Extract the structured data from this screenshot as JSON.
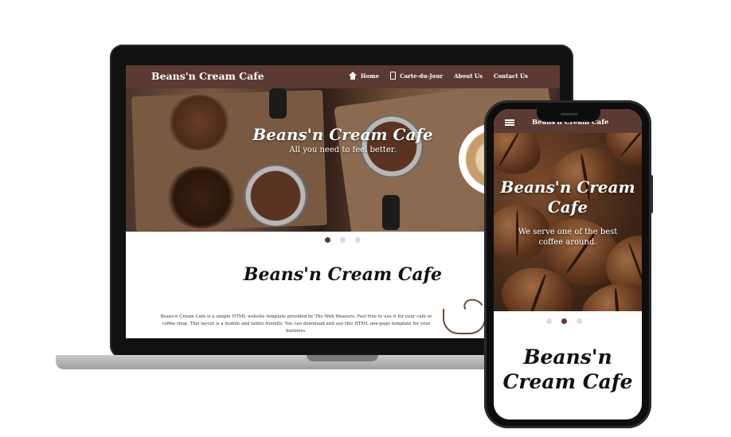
{
  "desktop": {
    "brand": "Beans'n Cream Cafe",
    "nav": [
      {
        "label": "Home",
        "icon": "home-icon"
      },
      {
        "label": "Carte-du-Jour",
        "icon": "clipboard-icon"
      },
      {
        "label": "About Us"
      },
      {
        "label": "Contact Us"
      }
    ],
    "hero": {
      "title": "Beans'n Cream Cafe",
      "subtitle": "All you need to feel better."
    },
    "carousel": {
      "count": 3,
      "active": 1
    },
    "section": {
      "title": "Beans'n Cream Cafe",
      "text": "Beans'n Cream Cafe is a simple HTML website template provided by The Web Weavers. Feel free to use it for your cafe or coffee shop. This layout is a mobile and tablet friendly. You can download and use this HTML one-page template for your business."
    }
  },
  "mobile": {
    "brand": "Beans'n Cream Cafe",
    "hero": {
      "title": "Beans'n Cream Cafe",
      "subtitle": "We serve one of the best coffee around."
    },
    "carousel": {
      "count": 3,
      "active": 2
    },
    "section": {
      "title": "Beans'n Cream Cafe"
    }
  },
  "colors": {
    "nav_bg": "#5b3a33",
    "dot_active": "#5b3a33",
    "dot_inactive": "#dcdcdc"
  }
}
